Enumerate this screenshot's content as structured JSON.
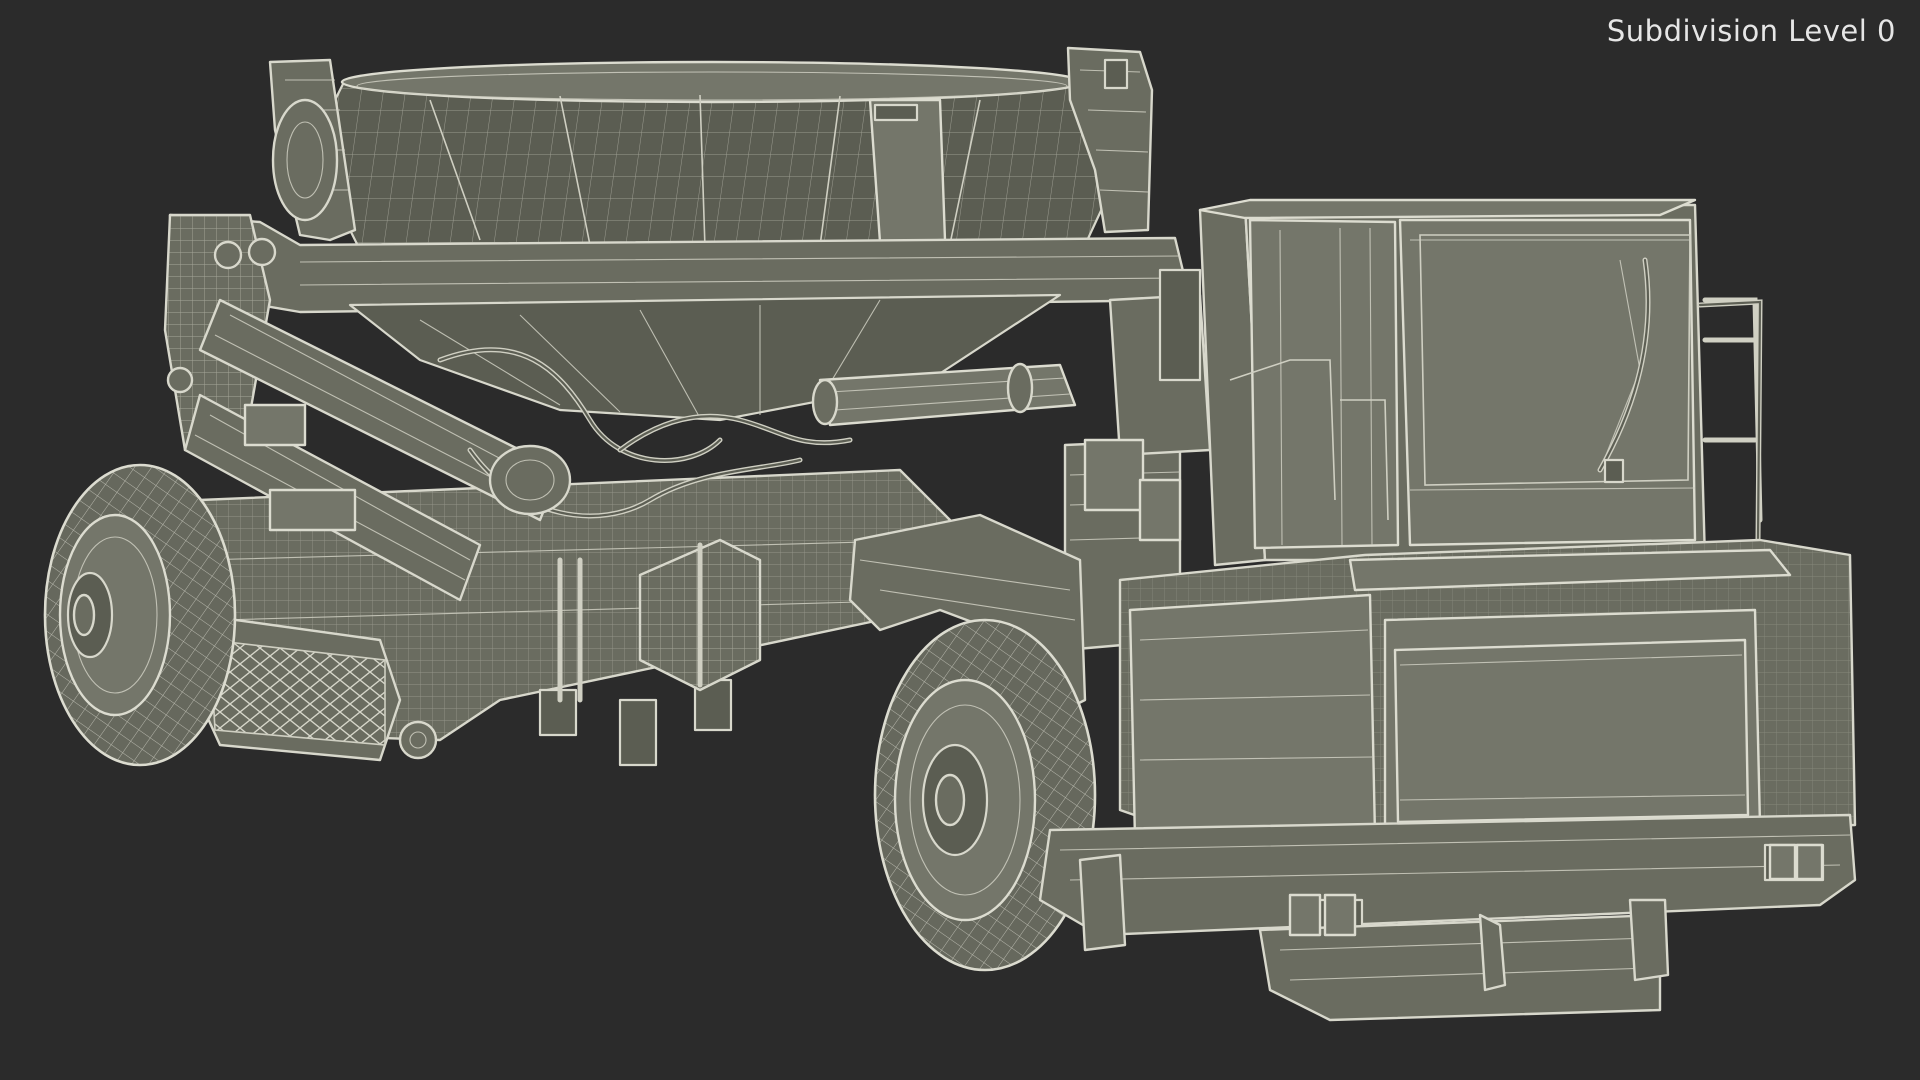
{
  "viewport": {
    "overlay_label": "Subdivision Level 0",
    "background_color": "#2b2b2b",
    "mesh_fill_color": "#6a6c60",
    "wire_color": "#d8d8cc"
  }
}
